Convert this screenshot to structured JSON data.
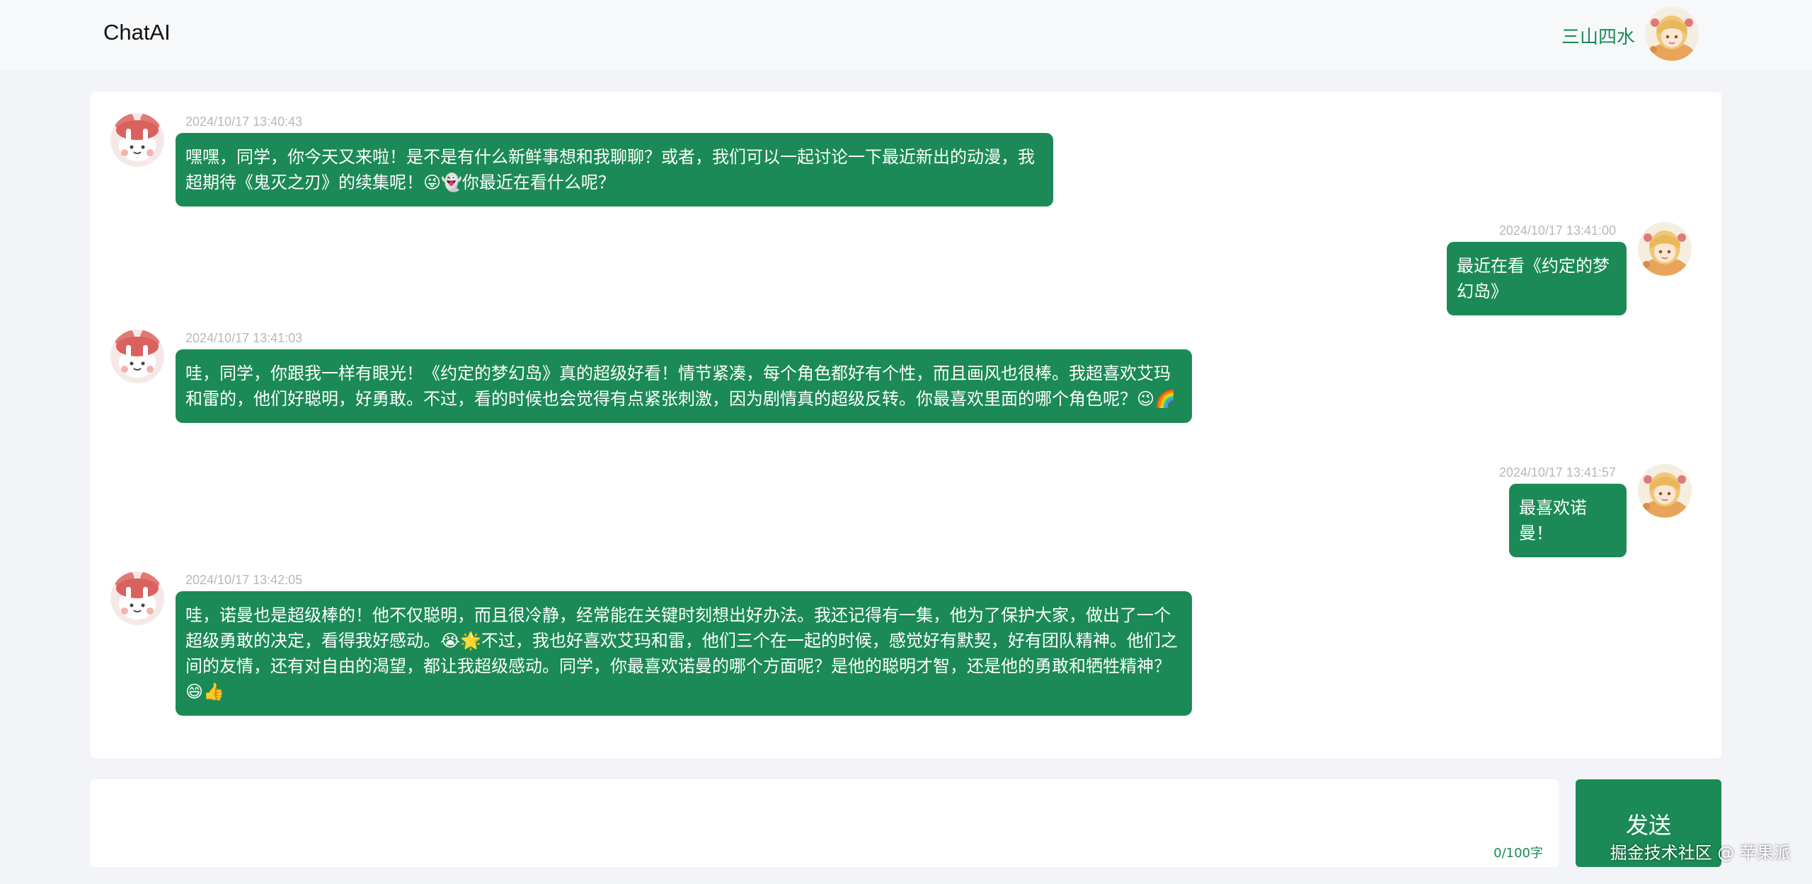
{
  "header": {
    "app_title": "ChatAI",
    "user_name": "三山四水"
  },
  "messages": [
    {
      "role": "bot",
      "timestamp": "2024/10/17 13:40:43",
      "text": "嘿嘿，同学，你今天又来啦！是不是有什么新鲜事想和我聊聊？或者，我们可以一起讨论一下最近新出的动漫，我超期待《鬼灭之刃》的续集呢！😜👻你最近在看什么呢？"
    },
    {
      "role": "user",
      "timestamp": "2024/10/17 13:41:00",
      "text": "最近在看《约定的梦幻岛》"
    },
    {
      "role": "bot",
      "timestamp": "2024/10/17 13:41:03",
      "text": "哇，同学，你跟我一样有眼光！《约定的梦幻岛》真的超级好看！情节紧凑，每个角色都好有个性，而且画风也很棒。我超喜欢艾玛和雷的，他们好聪明，好勇敢。不过，看的时候也会觉得有点紧张刺激，因为剧情真的超级反转。你最喜欢里面的哪个角色呢？😉🌈"
    },
    {
      "role": "user",
      "timestamp": "2024/10/17 13:41:57",
      "text": "最喜欢诺曼！"
    },
    {
      "role": "bot",
      "timestamp": "2024/10/17 13:42:05",
      "text": "哇，诺曼也是超级棒的！他不仅聪明，而且很冷静，经常能在关键时刻想出好办法。我还记得有一集，他为了保护大家，做出了一个超级勇敢的决定，看得我好感动。😭🌟不过，我也好喜欢艾玛和雷，他们三个在一起的时候，感觉好有默契，好有团队精神。他们之间的友情，还有对自由的渴望，都让我超级感动。同学，你最喜欢诺曼的哪个方面呢？是他的聪明才智，还是他的勇敢和牺牲精神？😄👍"
    }
  ],
  "input": {
    "value": "",
    "placeholder": "",
    "char_count": "0/100字"
  },
  "send_button": {
    "label": "发送"
  },
  "watermark": "掘金技术社区 @ 苹果派",
  "colors": {
    "accent": "#1b8a56",
    "background": "#f2f4f7",
    "panel": "#ffffff",
    "timestamp": "#b8b8b8"
  },
  "icons": {
    "bot_avatar": "bunny-avatar-icon",
    "user_avatar": "anime-girl-avatar-icon"
  }
}
